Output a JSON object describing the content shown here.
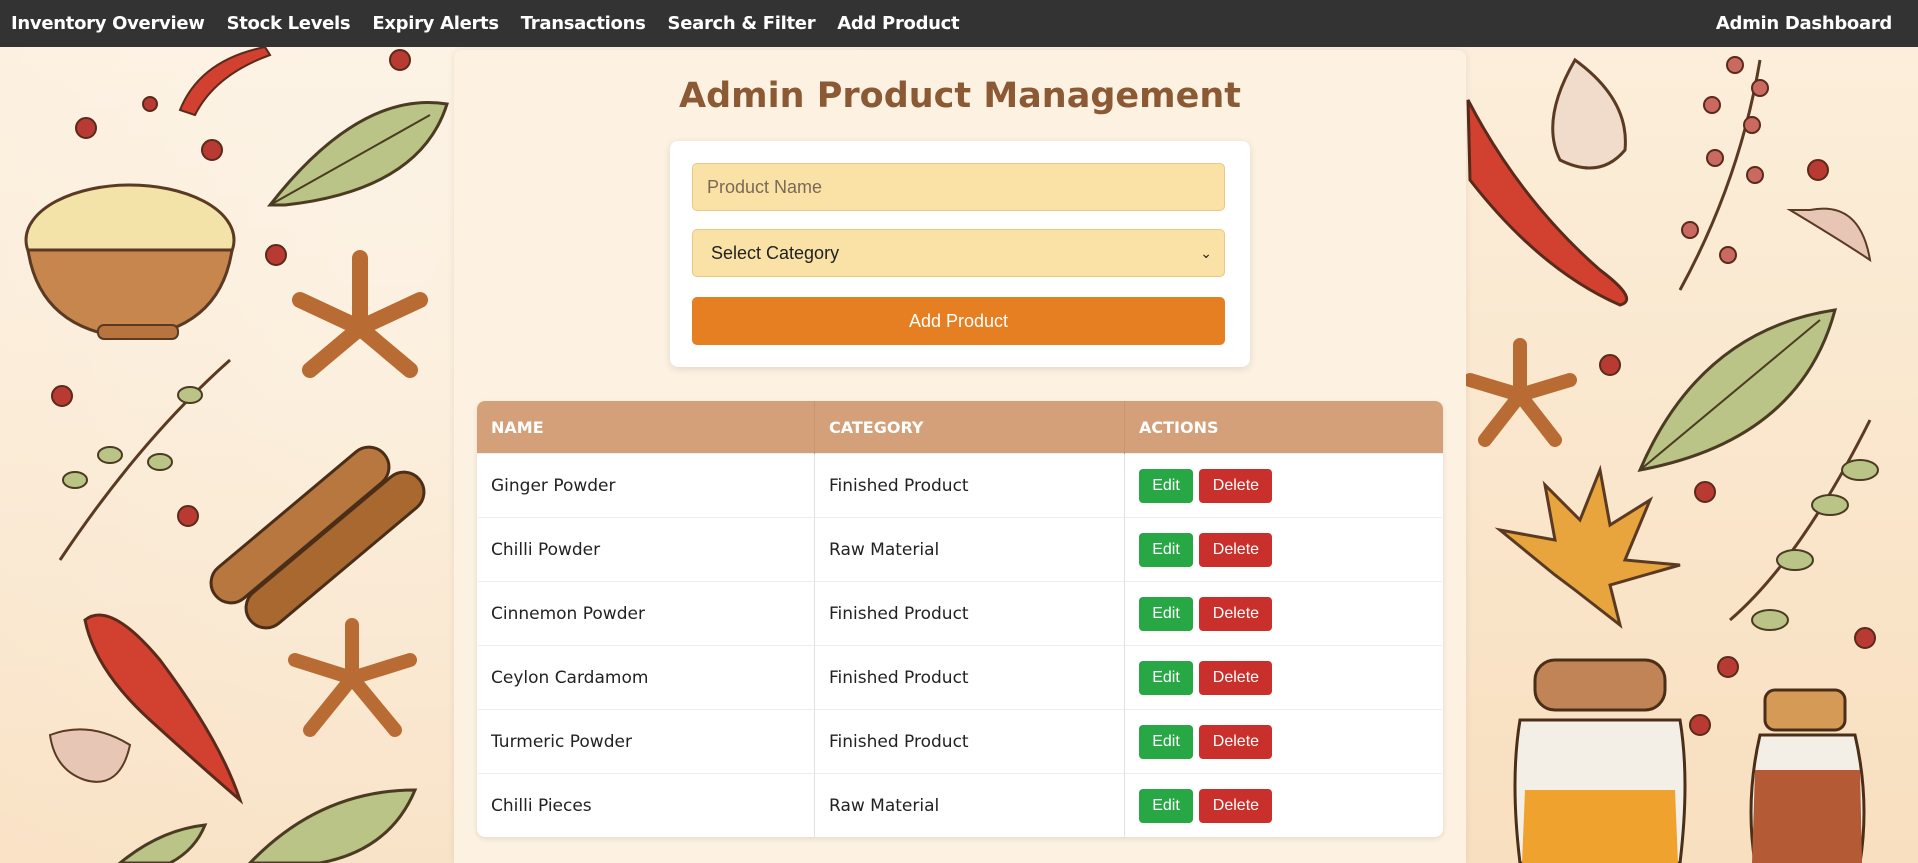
{
  "nav": {
    "links": [
      {
        "label": "Inventory Overview"
      },
      {
        "label": "Stock Levels"
      },
      {
        "label": "Expiry Alerts"
      },
      {
        "label": "Transactions"
      },
      {
        "label": "Search & Filter"
      },
      {
        "label": "Add Product"
      }
    ],
    "right_label": "Admin Dashboard"
  },
  "page": {
    "title": "Admin Product Management"
  },
  "form": {
    "name_placeholder": "Product Name",
    "category_selected": "Select Category",
    "submit_label": "Add Product"
  },
  "table": {
    "headers": [
      "NAME",
      "CATEGORY",
      "ACTIONS"
    ],
    "rows": [
      {
        "name": "Ginger Powder",
        "category": "Finished Product"
      },
      {
        "name": "Chilli Powder",
        "category": "Raw Material"
      },
      {
        "name": "Cinnemon Powder",
        "category": "Finished Product"
      },
      {
        "name": "Ceylon Cardamom",
        "category": "Finished Product"
      },
      {
        "name": "Turmeric Powder",
        "category": "Finished Product"
      },
      {
        "name": "Chilli Pieces",
        "category": "Raw Material"
      }
    ],
    "edit_label": "Edit",
    "delete_label": "Delete"
  },
  "colors": {
    "navbar": "#333333",
    "title": "#8b5a34",
    "header": "#d4a07a",
    "add_button": "#e67e22",
    "edit": "#28a745",
    "delete": "#c9302c"
  }
}
